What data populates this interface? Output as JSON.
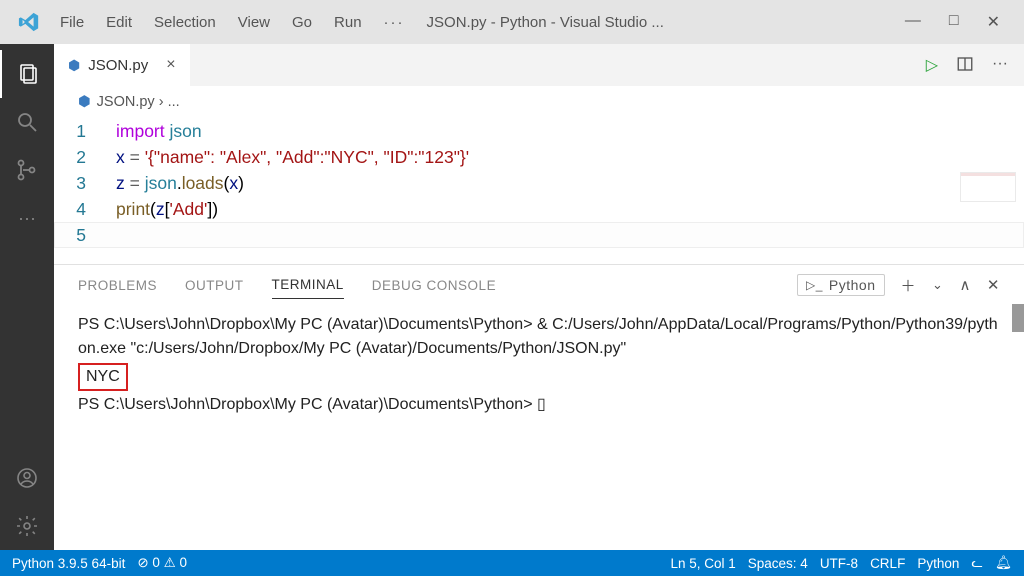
{
  "titlebar": {
    "menus": [
      "File",
      "Edit",
      "Selection",
      "View",
      "Go",
      "Run"
    ],
    "overflow": "···",
    "title": "JSON.py - Python - Visual Studio ..."
  },
  "tabs": {
    "filename": "JSON.py"
  },
  "breadcrumb": {
    "file": "JSON.py",
    "tail": " › ..."
  },
  "code": {
    "l1_kw": "import",
    "l1_sp": " ",
    "l1_mod": "json",
    "l2_v": "x",
    "l2_eq": " = ",
    "l2_s": "'{\"name\": \"Alex\", \"Add\":\"NYC\", \"ID\":\"123\"}'",
    "l3_v": "z",
    "l3_eq": " = ",
    "l3_mod": "json",
    "l3_dot": ".",
    "l3_fn": "loads",
    "l3_open": "(",
    "l3_arg": "x",
    "l3_close": ")",
    "l4_fn": "print",
    "l4_open": "(",
    "l4_v": "z",
    "l4_b1": "[",
    "l4_key": "'Add'",
    "l4_b2": "])",
    "gutters": [
      "1",
      "2",
      "3",
      "4",
      "5"
    ]
  },
  "panel": {
    "tabs": [
      "PROBLEMS",
      "OUTPUT",
      "TERMINAL",
      "DEBUG CONSOLE"
    ],
    "shell": "Python"
  },
  "terminal": {
    "line1": "PS C:\\Users\\John\\Dropbox\\My PC (Avatar)\\Documents\\Python> & C:/Users/John/AppData/Local/Programs/Python/Python39/python.exe \"c:/Users/John/Dropbox/My PC (Avatar)/Documents/Python/JSON.py\"",
    "out": "NYC",
    "prompt2": "PS C:\\Users\\John\\Dropbox\\My PC (Avatar)\\Documents\\Python> ",
    "cursor": "▯"
  },
  "status": {
    "interpreter": "Python 3.9.5 64-bit",
    "errs": "⊘ 0 ⚠ 0",
    "pos": "Ln 5, Col 1",
    "spaces": "Spaces: 4",
    "enc": "UTF-8",
    "eol": "CRLF",
    "lang": "Python"
  }
}
